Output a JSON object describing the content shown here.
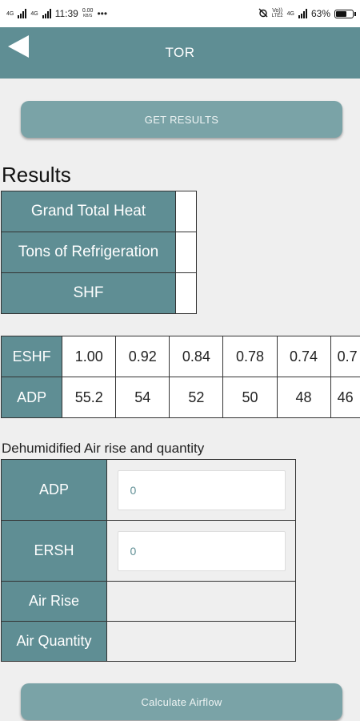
{
  "status_bar": {
    "left_net_a": "4G",
    "left_net_b": "4G",
    "time": "11:39",
    "speed_top": "0.00",
    "speed_bottom": "KB/S",
    "more": "•••",
    "volte": "Vo))",
    "volte_sub": "LTE2",
    "right_net": "4G",
    "battery": "63%",
    "battery_level": 0.63
  },
  "header": {
    "title": "TOR"
  },
  "actions": {
    "get_results": "GET RESULTS",
    "calculate_airflow": "Calculate Airflow"
  },
  "results": {
    "title": "Results",
    "rows": [
      {
        "label": "Grand Total Heat",
        "value": ""
      },
      {
        "label": "Tons of Refrigeration",
        "value": ""
      },
      {
        "label": "SHF",
        "value": ""
      }
    ]
  },
  "eshf_table": {
    "eshf_label": "ESHF",
    "adp_label": "ADP",
    "eshf_values": [
      "1.00",
      "0.92",
      "0.84",
      "0.78",
      "0.74",
      "0.7"
    ],
    "adp_values": [
      "55.2",
      "54",
      "52",
      "50",
      "48",
      "46"
    ]
  },
  "dehumidified": {
    "title": "Dehumidified Air rise and quantity",
    "adp_label": "ADP",
    "adp_value": "0",
    "ersh_label": "ERSH",
    "ersh_value": "0",
    "air_rise_label": "Air Rise",
    "air_rise_value": "",
    "air_quantity_label": "Air Quantity",
    "air_quantity_value": ""
  },
  "colors": {
    "header": "#5f8e94",
    "button": "#7aa3a7",
    "background": "#efefef"
  }
}
